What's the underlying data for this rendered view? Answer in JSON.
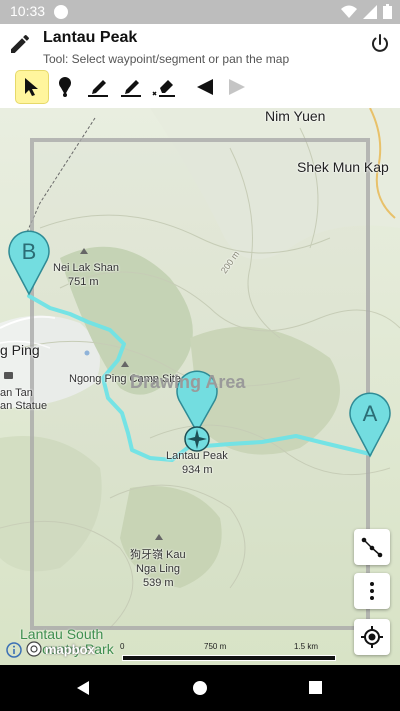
{
  "status": {
    "time": "10:33"
  },
  "header": {
    "title": "Lantau Peak",
    "subtitle": "Tool: Select waypoint/segment or pan the map"
  },
  "toolbar": {
    "tools": [
      "select-tool",
      "add-waypoint-tool",
      "draw-segment-tool",
      "edit-segment-tool",
      "erase-tool",
      "undo",
      "redo"
    ]
  },
  "map": {
    "labels": {
      "nim_yuen": "Nim Yuen",
      "shek_mun_kap": "Shek Mun Kap",
      "nei_lak_shan": "Nei Lak Shan",
      "nei_lak_shan_elev": "751 m",
      "contour_200": "200 m",
      "ngong_ping_partial": "g Ping",
      "ngong_ping_camp": "Ngong Ping Camp Site",
      "drawing_area": "Drawing Area",
      "tian_tan_partial": "an Tan",
      "buddha_partial": "an Statue",
      "lantau_peak": "Lantau Peak",
      "lantau_peak_elev": "934 m",
      "kau_chinese": "狗牙嶺 Kau",
      "nga_ling": "Nga Ling",
      "nga_ling_elev": "539 m",
      "lantau_south": "Lantau South",
      "country_park": "Country Park",
      "mapbox": "mapbox"
    },
    "markers": {
      "a": "A",
      "b": "B"
    },
    "scale": {
      "start": "0",
      "mid": "750 m",
      "end": "1.5 km"
    },
    "colors": {
      "route": "#6fe3e6",
      "marker": "#73dde0"
    }
  }
}
